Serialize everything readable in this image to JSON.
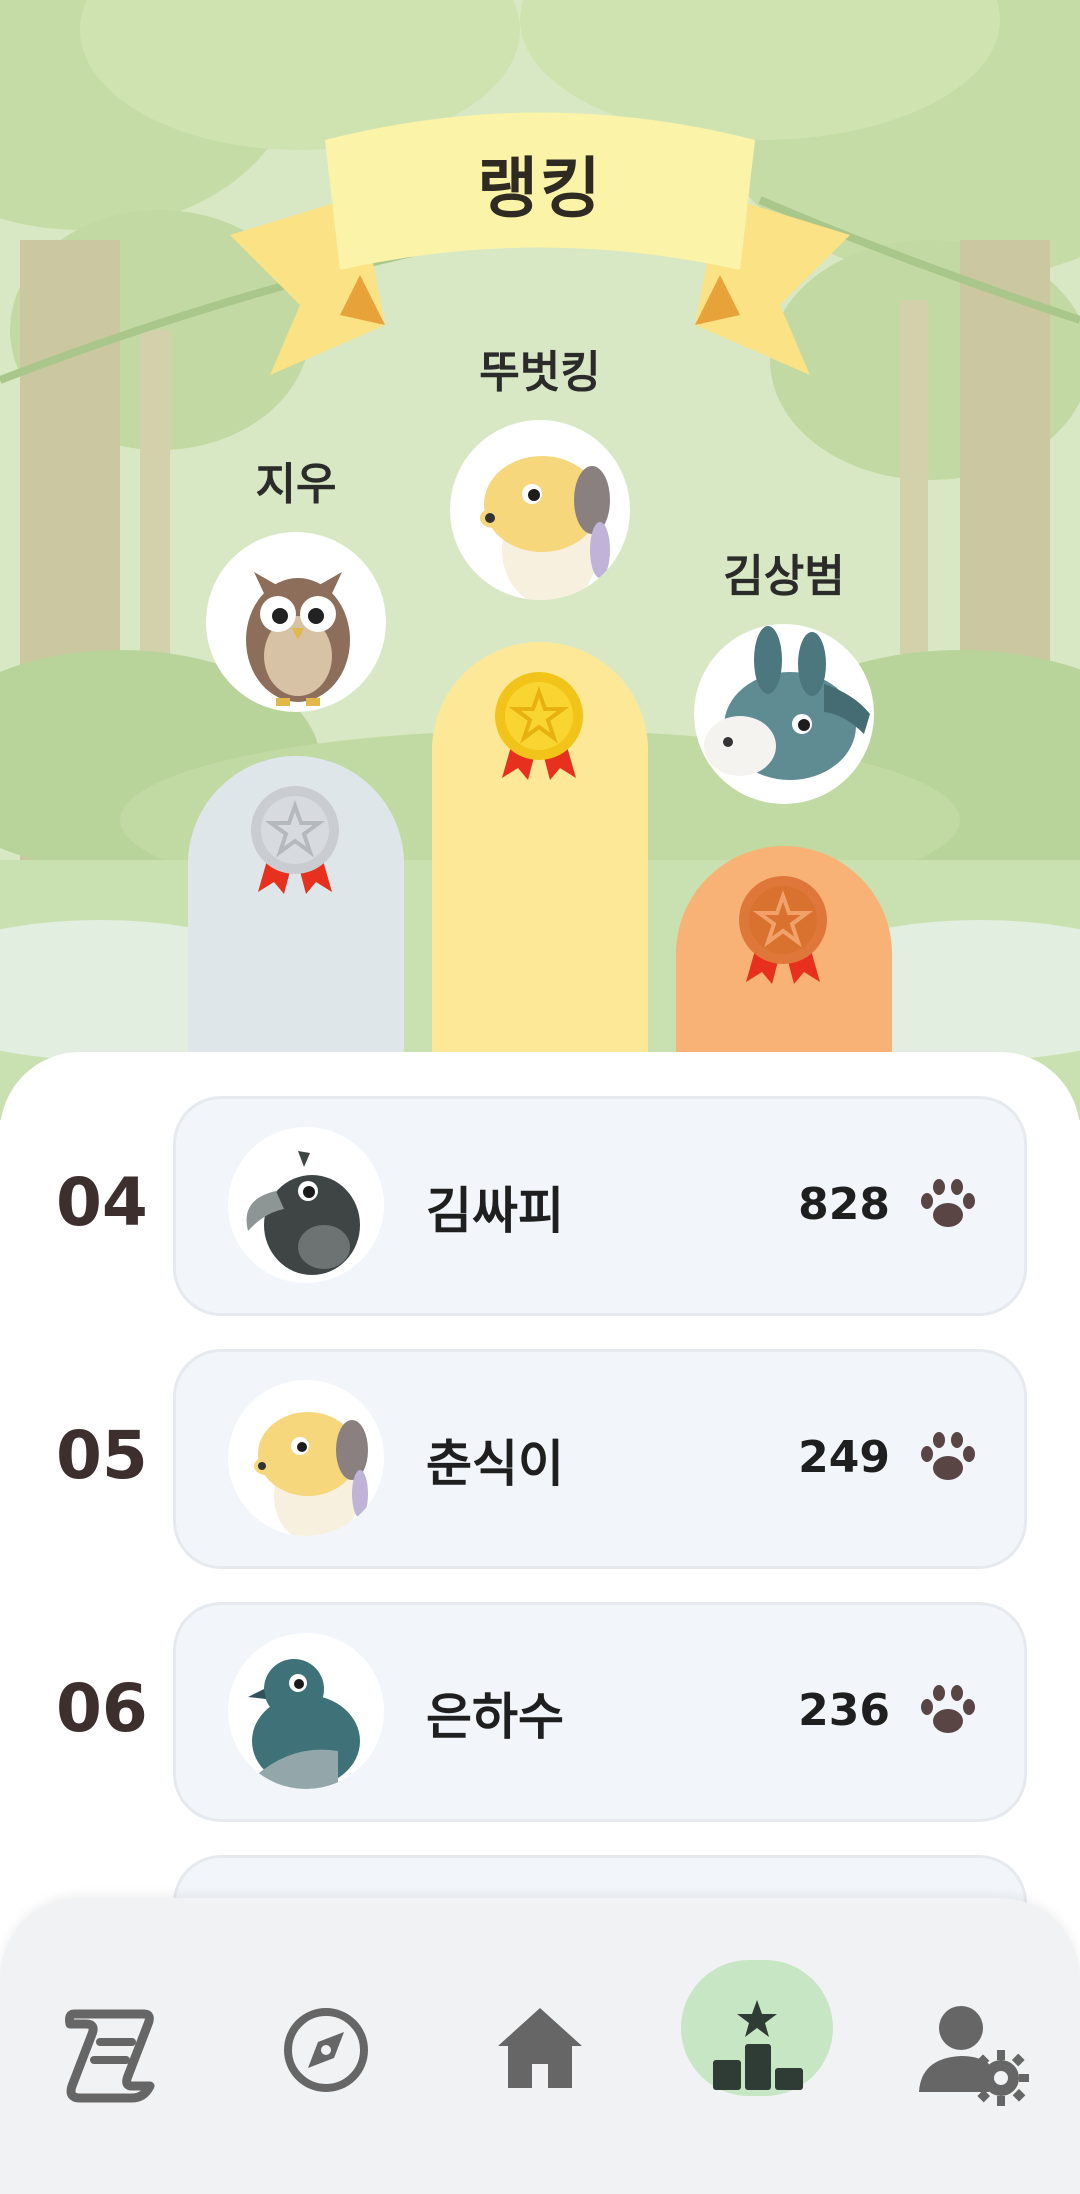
{
  "header": {
    "title": "랭킹"
  },
  "podium": [
    {
      "place": "first",
      "name": "뚜벗킹",
      "avatar": "yellow-dog",
      "medal": "gold-medal-icon"
    },
    {
      "place": "second",
      "name": "지우",
      "avatar": "brown-owl",
      "medal": "silver-medal-icon"
    },
    {
      "place": "third",
      "name": "김상범",
      "avatar": "gray-donkey",
      "medal": "bronze-medal-icon"
    }
  ],
  "rankings": [
    {
      "rank": "04",
      "name": "김싸피",
      "score": "828",
      "avatar": "dark-bird"
    },
    {
      "rank": "05",
      "name": "춘식이",
      "score": "249",
      "avatar": "yellow-dog"
    },
    {
      "rank": "06",
      "name": "은하수",
      "score": "236",
      "avatar": "teal-pigeon"
    }
  ],
  "bottom_nav": [
    {
      "name": "quests",
      "icon": "scroll-icon",
      "active": false
    },
    {
      "name": "explore",
      "icon": "compass-icon",
      "active": false
    },
    {
      "name": "home",
      "icon": "home-icon",
      "active": false
    },
    {
      "name": "ranking",
      "icon": "podium-star-icon",
      "active": true
    },
    {
      "name": "settings",
      "icon": "user-gear-icon",
      "active": false
    }
  ],
  "colors": {
    "gold_pillar": "#fde898",
    "silver_pillar": "#dfe6ea",
    "bronze_pillar": "#f9b275",
    "active_nav": "#c7e6c4",
    "rank_number": "#3e2f2f",
    "paw": "#5a4545"
  }
}
